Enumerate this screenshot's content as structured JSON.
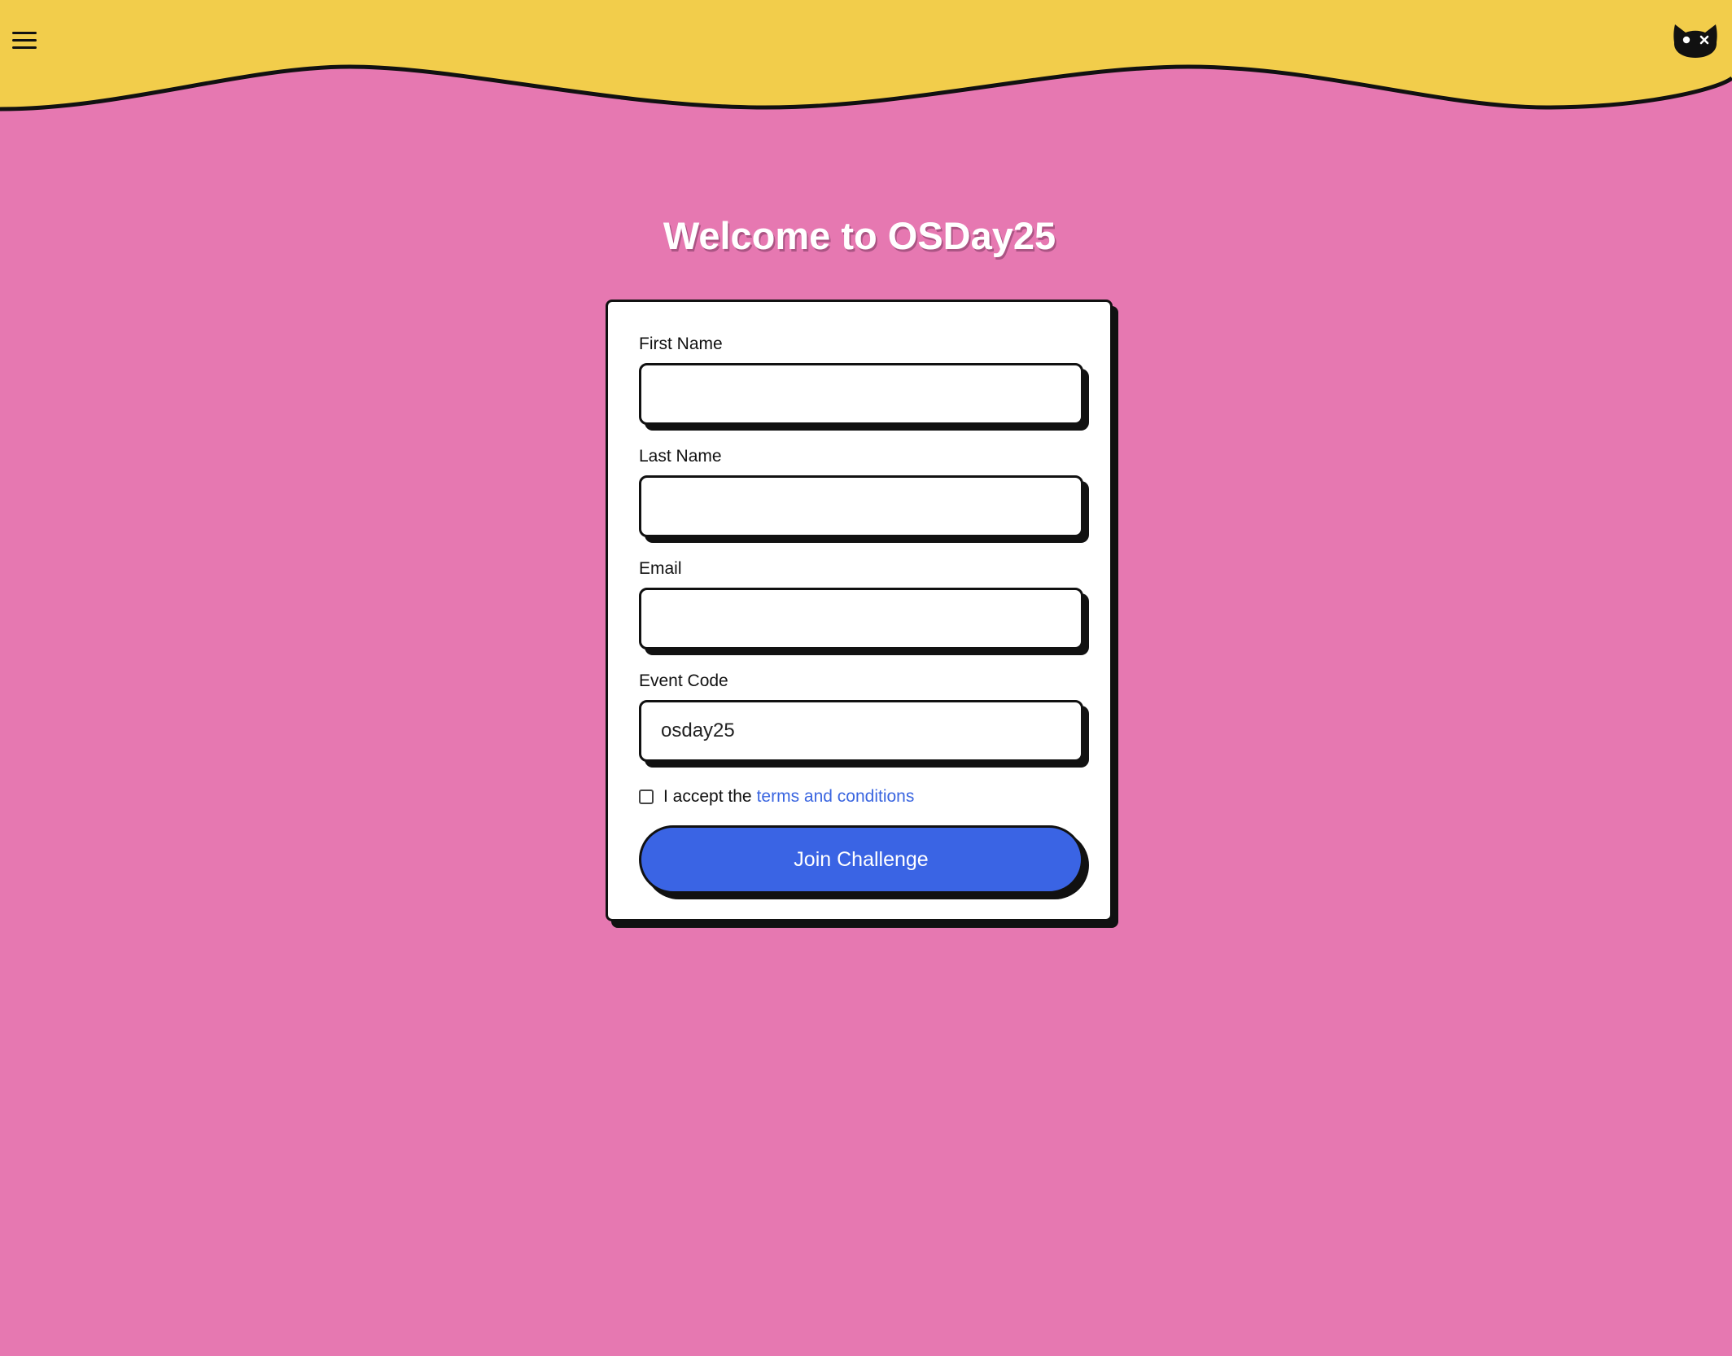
{
  "header": {
    "menu_icon": "hamburger-menu-icon",
    "logo_icon": "cat-logo-icon",
    "background_color": "#f2cd4b"
  },
  "page": {
    "background_color": "#e678b1",
    "title": "Welcome to OSDay25"
  },
  "form": {
    "first_name": {
      "label": "First Name",
      "value": ""
    },
    "last_name": {
      "label": "Last Name",
      "value": ""
    },
    "email": {
      "label": "Email",
      "value": ""
    },
    "event_code": {
      "label": "Event Code",
      "value": "osday25"
    },
    "terms": {
      "checked": false,
      "text": "I accept the",
      "link_text": "terms and conditions"
    },
    "submit_label": "Join Challenge",
    "accent_color": "#3a64e4"
  }
}
